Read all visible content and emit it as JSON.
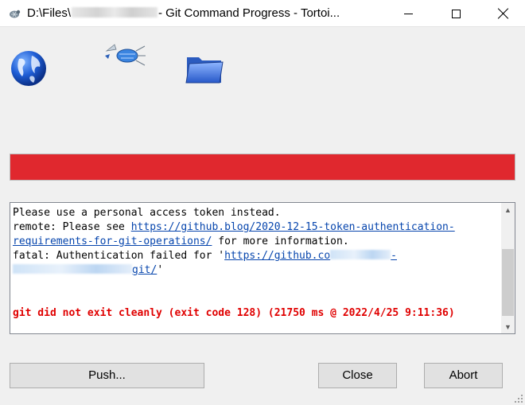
{
  "window": {
    "title_prefix": "D:\\Files\\",
    "title_suffix": "- Git Command Progress - Tortoi...",
    "controls": {
      "minimize": "minimize-icon",
      "maximize": "maximize-icon",
      "close": "close-icon"
    }
  },
  "animation": {
    "icons": [
      "globe-icon",
      "flying-files-icon",
      "folder-icon"
    ]
  },
  "progress": {
    "value": 1.0,
    "color": "#e0282e"
  },
  "log": {
    "lines": [
      {
        "parts": [
          {
            "text": "Please use a personal access token instead."
          }
        ]
      },
      {
        "parts": [
          {
            "text": "remote: Please see "
          },
          {
            "text": "https://github.blog/2020-12-15-token-authentication-",
            "link": true
          }
        ]
      },
      {
        "parts": [
          {
            "text": "requirements-for-git-operations/",
            "link": true
          },
          {
            "text": " for more information."
          }
        ]
      },
      {
        "parts": [
          {
            "text": "fatal: Authentication failed for '"
          },
          {
            "text": "https://github.co",
            "link": true
          },
          {
            "blur": 76
          },
          {
            "text": "-",
            "link": true
          }
        ]
      },
      {
        "parts": [
          {
            "blur": 150
          },
          {
            "text": "git/",
            "link": true
          },
          {
            "text": "'"
          }
        ]
      },
      {
        "parts": [
          {
            "text": ""
          }
        ]
      },
      {
        "parts": [
          {
            "text": ""
          }
        ]
      },
      {
        "parts": [
          {
            "text": "git did not exit cleanly (exit code 128) (21750 ms @ 2022/4/25 9:11:36)",
            "error": true
          }
        ]
      }
    ],
    "colors": {
      "link": "#0645ad",
      "error": "#e00000"
    }
  },
  "buttons": {
    "push": "Push...",
    "close": "Close",
    "abort": "Abort"
  }
}
